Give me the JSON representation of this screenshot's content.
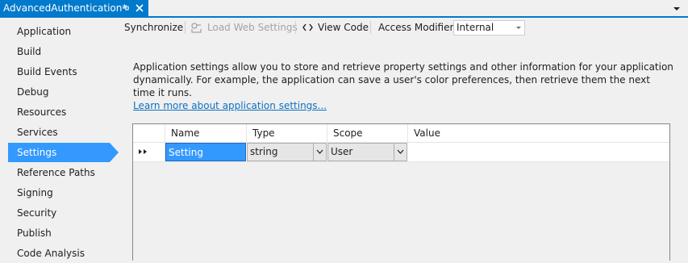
{
  "tab": {
    "title": "AdvancedAuthentication*",
    "pin_icon": "pin-icon",
    "close_icon": "close-icon",
    "dropdown_icon": "chevron-down-icon",
    "accent": "#007acc"
  },
  "nav": {
    "items": [
      {
        "label": "Application"
      },
      {
        "label": "Build"
      },
      {
        "label": "Build Events"
      },
      {
        "label": "Debug"
      },
      {
        "label": "Resources"
      },
      {
        "label": "Services"
      },
      {
        "label": "Settings"
      },
      {
        "label": "Reference Paths"
      },
      {
        "label": "Signing"
      },
      {
        "label": "Security"
      },
      {
        "label": "Publish"
      },
      {
        "label": "Code Analysis"
      }
    ],
    "selected": "Settings",
    "selected_color": "#3399ff"
  },
  "toolbar": {
    "synchronize": "Synchronize",
    "load_web_settings": "Load Web Settings",
    "view_code": "View Code",
    "view_code_icon": "code-brackets-icon",
    "load_icon": "web-settings-icon",
    "access_modifier_label": "Access Modifier:",
    "access_modifier_value": "Internal"
  },
  "description": {
    "line1": "Application settings allow you to store and retrieve property settings and other information for your application",
    "line2": "dynamically. For example, the application can save a user's color preferences, then retrieve them the next time it runs.",
    "link": "Learn more about application settings..."
  },
  "grid": {
    "columns": [
      "Name",
      "Type",
      "Scope",
      "Value"
    ],
    "rows": [
      {
        "name": "Setting",
        "type": "string",
        "scope": "User",
        "value": ""
      }
    ],
    "row_indicator_icon": "new-row-indicator-icon"
  }
}
